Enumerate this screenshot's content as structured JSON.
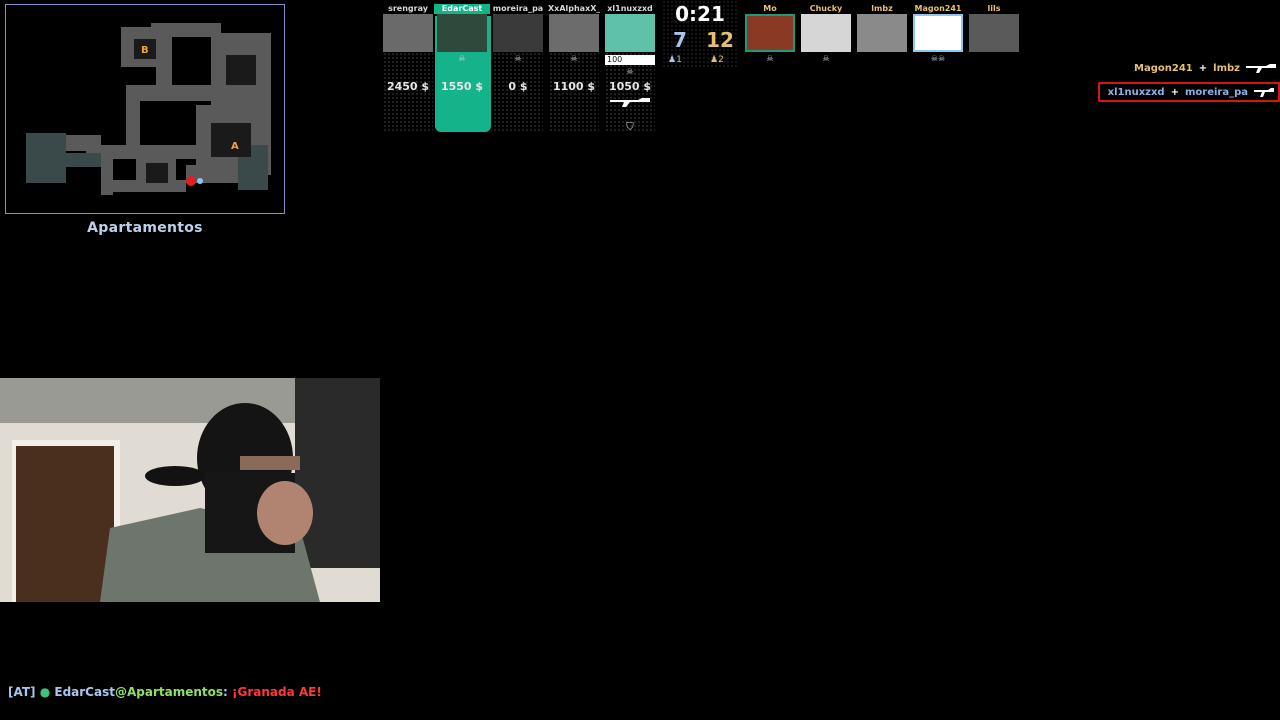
{
  "radar": {
    "site_a": "A",
    "site_b": "B",
    "location_name": "Apartamentos"
  },
  "scoreboard": {
    "timer": "0:21",
    "ct_score": "7",
    "t_score": "12",
    "ct_alive": "1",
    "t_alive": "2",
    "ct_players": [
      {
        "name": "srengray",
        "money": "2450 $",
        "avatar_color": "#6a6a6a"
      },
      {
        "name": "EdarCast",
        "money": "1550 $",
        "avatar_color": "#2f4a3c"
      },
      {
        "name": "moreira_pa",
        "money": "0 $",
        "avatar_color": "#3a3a3a"
      },
      {
        "name": "XxAlphaxX_",
        "money": "1100 $",
        "avatar_color": "#6c6c6c"
      },
      {
        "name": "xl1nuxzxd",
        "money": "1050 $",
        "health": "100",
        "avatar_color": "#5fc2a8"
      }
    ],
    "t_players": [
      {
        "name": "Mo",
        "avatar_color": "#8a3a24"
      },
      {
        "name": "Chucky",
        "avatar_color": "#d6d6d6"
      },
      {
        "name": "lmbz",
        "avatar_color": "#8a8a8a"
      },
      {
        "name": "Magon241",
        "avatar_color": "#ffffff"
      },
      {
        "name": "lils",
        "avatar_color": "#5a5a5a"
      }
    ]
  },
  "killfeed": [
    {
      "attacker": "Magon241",
      "assister": "lmbz",
      "plus": "+",
      "team": "t",
      "weapon_icon": "rifle-icon"
    },
    {
      "attacker": "xl1nuxzxd",
      "assister": "moreira_pa",
      "plus": "+",
      "team": "ct",
      "weapon_icon": "rifle-icon"
    }
  ],
  "chat": {
    "tag": "[AT]",
    "dot": "●",
    "sender": "EdarCast",
    "at": "@",
    "location": "Apartamentos",
    "colon": ":",
    "message": "¡Granada AE!"
  },
  "colors": {
    "ct": "#a9c6ec",
    "t": "#e6c072",
    "highlight": "#14b38a",
    "killfeed_border": "#d01616"
  }
}
